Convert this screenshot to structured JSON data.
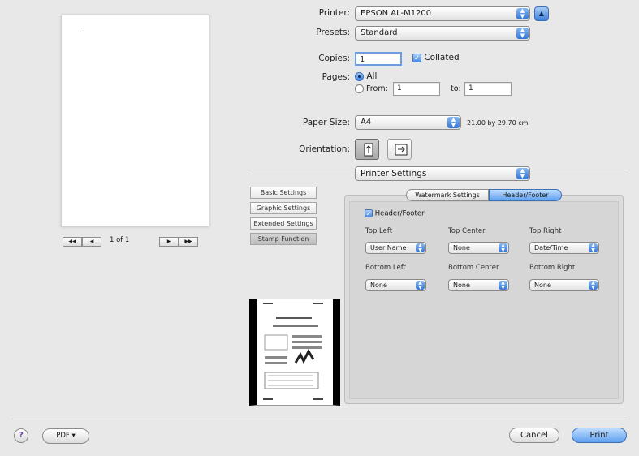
{
  "labels": {
    "printer": "Printer:",
    "presets": "Presets:",
    "copies": "Copies:",
    "pages": "Pages:",
    "paper_size": "Paper Size:",
    "orientation": "Orientation:"
  },
  "printer": {
    "value": "EPSON AL-M1200"
  },
  "presets": {
    "value": "Standard"
  },
  "copies": {
    "value": "1",
    "collated_label": "Collated",
    "collated": true
  },
  "pages": {
    "all_label": "All",
    "from_label": "From:",
    "from_value": "1",
    "to_label": "to:",
    "to_value": "1"
  },
  "paper_size": {
    "value": "A4",
    "dimensions": "21.00 by 29.70 cm"
  },
  "section_popup": {
    "value": "Printer Settings"
  },
  "preview": {
    "page_info": "1 of 1",
    "nav_first": "◀◀",
    "nav_prev": "◀",
    "nav_next": "▶",
    "nav_last": "▶▶"
  },
  "side_buttons": [
    "Basic Settings",
    "Graphic Settings",
    "Extended Settings",
    "Stamp Function"
  ],
  "tabs": {
    "watermark": "Watermark Settings",
    "header_footer": "Header/Footer"
  },
  "header_footer": {
    "enable_label": "Header/Footer",
    "top_left": {
      "label": "Top Left",
      "value": "User Name"
    },
    "top_center": {
      "label": "Top Center",
      "value": "None"
    },
    "top_right": {
      "label": "Top Right",
      "value": "Date/Time"
    },
    "bottom_left": {
      "label": "Bottom Left",
      "value": "None"
    },
    "bottom_center": {
      "label": "Bottom Center",
      "value": "None"
    },
    "bottom_right": {
      "label": "Bottom Right",
      "value": "None"
    }
  },
  "footer": {
    "help": "?",
    "pdf": "PDF ▾",
    "cancel": "Cancel",
    "print": "Print"
  },
  "colors": {
    "accent": "#4b8ce3",
    "window_bg": "#e8e8e8"
  }
}
